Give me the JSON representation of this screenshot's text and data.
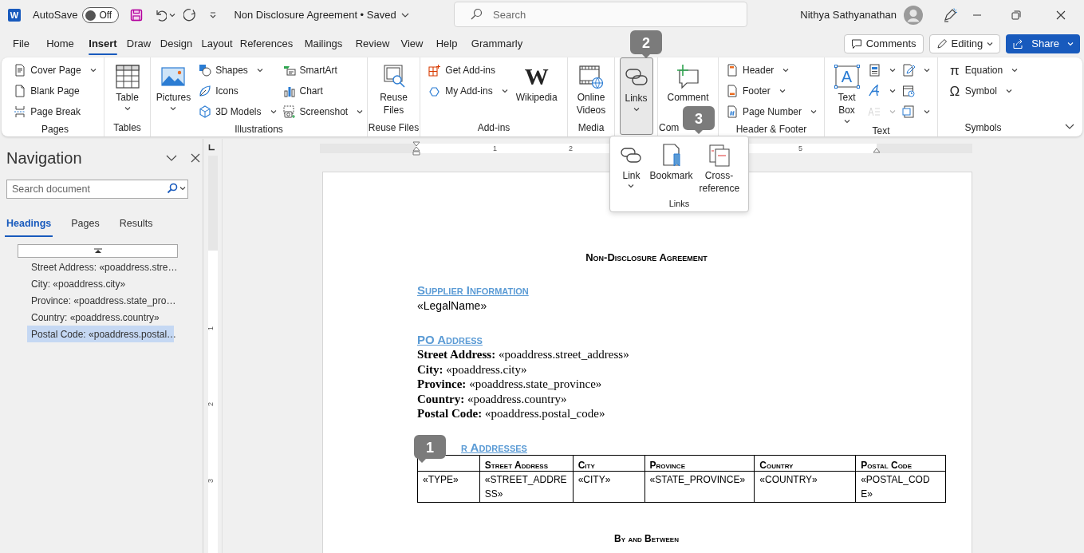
{
  "title_bar": {
    "app_logo": "W",
    "autosave": {
      "label": "AutoSave",
      "state_label": "Off",
      "on": false
    },
    "document_title": "Non Disclosure Agreement • Saved",
    "search": {
      "placeholder": "Search"
    },
    "user_name": "Nithya Sathyanathan"
  },
  "menu_tabs": [
    {
      "label": "File",
      "selected": false
    },
    {
      "label": "Home",
      "selected": false
    },
    {
      "label": "Insert",
      "selected": true
    },
    {
      "label": "Draw",
      "selected": false
    },
    {
      "label": "Design",
      "selected": false
    },
    {
      "label": "Layout",
      "selected": false
    },
    {
      "label": "References",
      "selected": false
    },
    {
      "label": "Mailings",
      "selected": false
    },
    {
      "label": "Review",
      "selected": false
    },
    {
      "label": "View",
      "selected": false
    },
    {
      "label": "Help",
      "selected": false
    },
    {
      "label": "Grammarly",
      "selected": false
    }
  ],
  "header_buttons": [
    {
      "label": "Comments",
      "kind": "outline"
    },
    {
      "label": "Editing",
      "kind": "dropdown"
    },
    {
      "label": "Share",
      "kind": "primary"
    }
  ],
  "ribbon": {
    "groups": [
      {
        "label": "Pages",
        "items": [
          {
            "label": "Cover Page",
            "kind": "small",
            "menu": true,
            "expanded": false
          },
          {
            "label": "Blank Page",
            "kind": "small",
            "menu": false,
            "expanded": false
          },
          {
            "label": "Page Break",
            "kind": "small",
            "menu": false,
            "expanded": false
          }
        ]
      },
      {
        "label": "Tables",
        "items": [
          {
            "label": "Table",
            "kind": "large",
            "menu": true,
            "expanded": false
          }
        ]
      },
      {
        "label": "Illustrations",
        "items": [
          {
            "label": "Pictures",
            "kind": "large",
            "menu": true,
            "expanded": false
          },
          {
            "label": "Shapes",
            "kind": "small",
            "menu": true,
            "expanded": false
          },
          {
            "label": "Icons",
            "kind": "small",
            "menu": false,
            "expanded": false
          },
          {
            "label": "3D Models",
            "kind": "small",
            "menu": true,
            "expanded": false
          },
          {
            "label": "SmartArt",
            "kind": "small",
            "menu": false,
            "expanded": false
          },
          {
            "label": "Chart",
            "kind": "small",
            "menu": false,
            "expanded": false
          },
          {
            "label": "Screenshot",
            "kind": "small",
            "menu": true,
            "expanded": false
          }
        ]
      },
      {
        "label": "Reuse Files",
        "items": [
          {
            "label": "Reuse Files",
            "kind": "large",
            "menu": false,
            "expanded": false
          }
        ]
      },
      {
        "label": "Add-ins",
        "items": [
          {
            "label": "Get Add-ins",
            "kind": "small",
            "menu": false,
            "expanded": false
          },
          {
            "label": "My Add-ins",
            "kind": "small",
            "menu": true,
            "expanded": false
          },
          {
            "label": "Wikipedia",
            "kind": "large",
            "glyph": "W",
            "menu": false,
            "expanded": false
          }
        ]
      },
      {
        "label": "Media",
        "items": [
          {
            "label": "Online Videos",
            "kind": "large",
            "menu": false,
            "expanded": false
          }
        ]
      },
      {
        "items": [
          {
            "label": "Links",
            "kind": "large",
            "menu": true,
            "expanded": true
          }
        ]
      },
      {
        "label": "Com",
        "items": [
          {
            "label": "Comment",
            "kind": "large",
            "menu": false,
            "expanded": false
          }
        ]
      },
      {
        "label": "Header & Footer",
        "items": [
          {
            "label": "Header",
            "kind": "small",
            "menu": true,
            "expanded": false
          },
          {
            "label": "Footer",
            "kind": "small",
            "menu": true,
            "expanded": false
          },
          {
            "label": "Page Number",
            "kind": "small",
            "menu": true,
            "expanded": false
          }
        ]
      },
      {
        "label": "Text",
        "items": [
          {
            "label": "Text Box",
            "kind": "large",
            "glyph": "A",
            "menu": true,
            "expanded": false,
            "disabled": false
          },
          {
            "kind": "icon",
            "menu": true,
            "expanded": false,
            "disabled": false
          },
          {
            "kind": "icon",
            "menu": true,
            "expanded": false,
            "disabled": false
          },
          {
            "kind": "icon",
            "menu": true,
            "expanded": false,
            "disabled": true
          },
          {
            "kind": "icon",
            "menu": true,
            "expanded": false,
            "disabled": false
          },
          {
            "kind": "icon",
            "menu": false,
            "expanded": false,
            "disabled": false
          },
          {
            "kind": "icon",
            "menu": true,
            "expanded": false,
            "disabled": false
          }
        ]
      },
      {
        "label": "Symbols",
        "items": [
          {
            "label": "Equation",
            "kind": "small",
            "glyph": "π",
            "menu": true,
            "expanded": false
          },
          {
            "label": "Symbol",
            "kind": "small",
            "glyph": "Ω",
            "menu": true,
            "expanded": false
          }
        ]
      }
    ]
  },
  "links_menu": {
    "label": "Links",
    "items": [
      {
        "label": "Link",
        "menu": true
      },
      {
        "label": "Bookmark",
        "menu": false
      },
      {
        "label": "Cross-reference",
        "menu": false
      }
    ]
  },
  "callouts": [
    {
      "number": "1"
    },
    {
      "number": "2"
    },
    {
      "number": "3"
    }
  ],
  "navigation": {
    "title": "Navigation",
    "search": {
      "placeholder": "Search document"
    },
    "tabs": [
      {
        "label": "Headings",
        "selected": true
      },
      {
        "label": "Pages",
        "selected": false
      },
      {
        "label": "Results",
        "selected": false
      }
    ],
    "headings": [
      {
        "label": "Street Address: «poaddress.stre…",
        "selected": false
      },
      {
        "label": "City: «poaddress.city»",
        "selected": false
      },
      {
        "label": "Province: «poaddress.state_pro…",
        "selected": false
      },
      {
        "label": "Country: «poaddress.country»",
        "selected": false
      },
      {
        "label": "Postal Code: «poaddress.postal…",
        "selected": true
      }
    ]
  },
  "rulers": {
    "horizontal": [
      "1",
      "2",
      "5"
    ],
    "vertical": [
      "1",
      "2",
      "3"
    ]
  },
  "document": {
    "title": "Non-Disclosure Agreement",
    "sections": [
      {
        "heading": "Supplier Information",
        "lines": [
          {
            "kind": "field",
            "text": "«LegalName»"
          }
        ]
      },
      {
        "heading": "PO Address",
        "lines": [
          {
            "kind": "labeled",
            "text": "**Street Address:** «poaddress.street_address»"
          },
          {
            "kind": "labeled",
            "text": "**City:** «poaddress.city»"
          },
          {
            "kind": "labeled",
            "text": "**Province:** «poaddress.state_province»"
          },
          {
            "kind": "labeled",
            "text": "**Country:** «poaddress.country»"
          },
          {
            "kind": "labeled",
            "text": "**Postal Code:** «poaddress.postal_code»"
          }
        ]
      },
      {
        "heading": "r Addresses",
        "table": {
          "columns": [
            "",
            "Street Address",
            "City",
            "Province",
            "Country",
            "Postal Code"
          ],
          "rows": [
            [
              "«TYPE»",
              "«STREET_ADDRESS»",
              "«CITY»",
              "«STATE_PROVINCE»",
              "«COUNTRY»",
              "«POSTAL_CODE»"
            ]
          ]
        }
      }
    ],
    "closing_heading": "By and Between"
  }
}
